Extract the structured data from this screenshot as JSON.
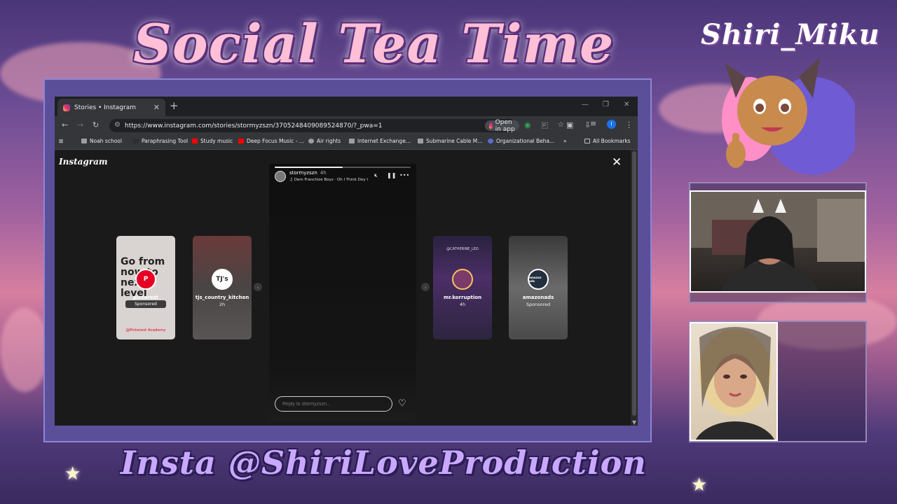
{
  "overlay": {
    "title": "Social Tea Time",
    "brand_name": "Shiri_Miku",
    "handle": "Insta @ShiriLoveProduction"
  },
  "browser": {
    "tab_title": "Stories • Instagram",
    "new_tab": "+",
    "url": "https://www.instagram.com/stories/stormyzszn/3705248409089524870/?_pwa=1",
    "open_in_app": "Open in app",
    "profile_initial": "I",
    "bookmarks": [
      {
        "label": "Noah school",
        "color": "#9aa0a6"
      },
      {
        "label": "Paraphrasing Tool",
        "color": "#2d2e30"
      },
      {
        "label": "Study music",
        "color": "#ff0000"
      },
      {
        "label": "Deep Focus Music - ...",
        "color": "#ff0000"
      },
      {
        "label": "Air rights",
        "color": "#9aa0a6"
      },
      {
        "label": "Internet Exchange...",
        "color": "#9aa0a6"
      },
      {
        "label": "Submarine Cable M...",
        "color": "#9aa0a6"
      },
      {
        "label": "Organizational Beha...",
        "color": "#5a6ad8"
      }
    ],
    "more_bookmarks": "»",
    "all_bookmarks": "All Bookmarks"
  },
  "instagram": {
    "logo": "Instagram",
    "stories": [
      {
        "name": "pinterest",
        "sub": "Sponsored",
        "ad_text": "Go from now to next level",
        "footer": "@Pinterest Academy"
      },
      {
        "name": "tjs_country_kitchen",
        "sub": "2h",
        "avatar_text": "TJ's"
      },
      {
        "name": "mr.korruption",
        "sub": "4h",
        "top_text": "@CATHERINE_LEO"
      },
      {
        "name": "amazonads",
        "sub": "Sponsored",
        "avatar_text": "amazon ads"
      }
    ],
    "main_story": {
      "username": "stormyzszn",
      "time": "4h",
      "song": "Dem Franchize Boyz · Oh I Think Dey I",
      "reply_placeholder": "Reply to stormyzszn...",
      "progress": 0.5
    }
  },
  "colors": {
    "accent_pink": "#ffbfd6",
    "accent_purple": "#c9a8ff",
    "instagram_red": "#e1306c"
  }
}
